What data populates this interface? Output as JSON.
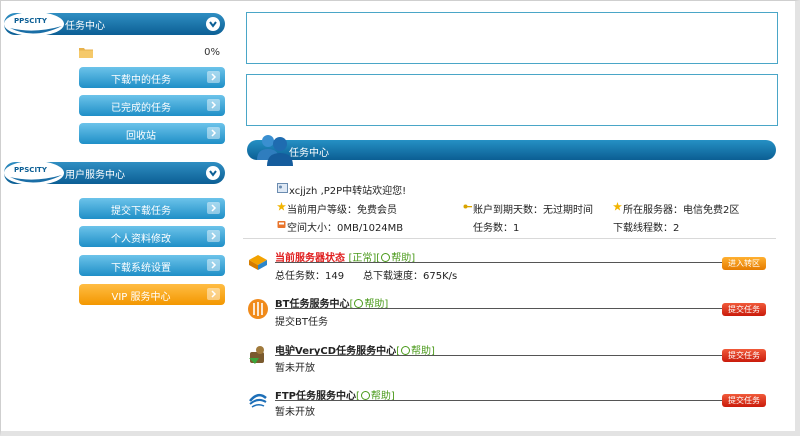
{
  "sidebar": {
    "logo_text": "PPSCITY",
    "task_section": {
      "title": "任务中心",
      "progress_label": "0%",
      "progress_value": 0
    },
    "task_buttons": [
      "下载中的任务",
      "已完成的任务",
      "回收站"
    ],
    "user_section": {
      "title": "用户服务中心"
    },
    "user_buttons": [
      "提交下载任务",
      "个人资料修改",
      "下载系统设置",
      "VIP 服务中心"
    ]
  },
  "main": {
    "center_title": "任务中心",
    "welcome": "xcjjzh ,P2P中转站欢迎您!",
    "info": {
      "level": "当前用户等级：免费会员",
      "expiry": "账户到期天数：无过期时间",
      "server": "所在服务器：电信免费2区",
      "space": "空间大小：0MB/1024MB",
      "tasks": "任务数：1",
      "threads": "下载线程数：2"
    },
    "server_status": {
      "title": "当前服务器状态",
      "state": "[正常]",
      "help": "帮助]",
      "help_bracket": "[",
      "total_tasks": "总任务数：149",
      "speed": "总下载速度：675K/s",
      "button": "进入转区"
    },
    "services": [
      {
        "title": "BT任务服务中心",
        "help_bracket": "[",
        "help": "帮助]",
        "desc": "提交BT任务",
        "button": "提交任务"
      },
      {
        "title": "电驴VeryCD任务服务中心",
        "help_bracket": "[",
        "help": "帮助]",
        "desc": "暂未开放",
        "button": "提交任务"
      },
      {
        "title": "FTP任务服务中心",
        "help_bracket": "[",
        "help": "帮助]",
        "desc": "暂未开放",
        "button": "提交任务"
      }
    ]
  },
  "colors": {
    "header_blue": "#0c5f95",
    "button_blue": "#1f8fc7",
    "vip_orange": "#f39700",
    "status_red": "#e02020",
    "help_green": "#4a9a1a"
  }
}
